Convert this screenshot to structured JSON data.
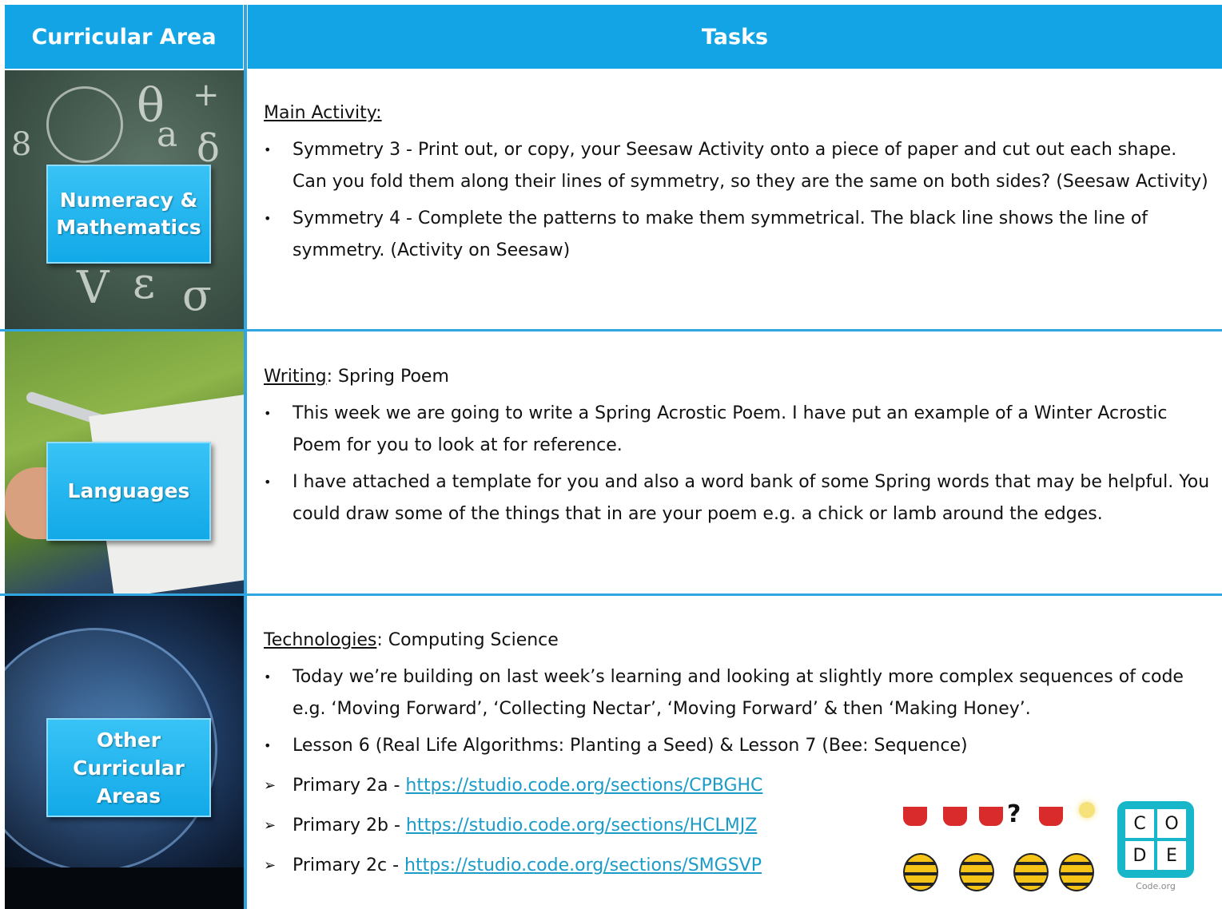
{
  "header": {
    "col_area": "Curricular Area",
    "col_tasks": "Tasks"
  },
  "rows": {
    "numeracy": {
      "label_line1": "Numeracy &",
      "label_line2": "Mathematics",
      "heading": "Main Activity:",
      "bullets": [
        "Symmetry 3 - Print out, or copy, your Seesaw Activity onto a piece of paper and cut out each shape. Can you fold them along their lines of symmetry, so they are the same on both sides? (Seesaw Activity)",
        "Symmetry 4 - Complete the patterns to make them symmetrical. The black line shows the line of symmetry. (Activity on Seesaw)"
      ]
    },
    "languages": {
      "label": "Languages",
      "heading_u": "Writing",
      "heading_rest": ": Spring Poem",
      "bullets": [
        "This week we are going to write a Spring Acrostic Poem. I have put an example of a Winter Acrostic Poem for you to look at for reference.",
        "I have attached a template for you and also a word bank of some Spring words that may be helpful. You could draw some of the things that in are your poem e.g. a chick or lamb around the edges."
      ]
    },
    "other": {
      "label_line1": "Other",
      "label_line2": "Curricular",
      "label_line3": "Areas",
      "heading_u": "Technologies",
      "heading_rest": ": Computing Science",
      "bullets": [
        "Today we’re building on last week’s learning and looking at slightly more complex sequences of code e.g. ‘Moving Forward’, ‘Collecting Nectar’, ‘Moving Forward’ & then ‘Making Honey’.",
        "Lesson 6 (Real Life Algorithms: Planting a Seed) & Lesson 7 (Bee: Sequence)"
      ],
      "links": [
        {
          "label": "Primary 2a - ",
          "url": "https://studio.code.org/sections/CPBGHC"
        },
        {
          "label": "Primary 2b - ",
          "url": "https://studio.code.org/sections/HCLMJZ"
        },
        {
          "label": "Primary 2c - ",
          "url": "https://studio.code.org/sections/SMGSVP"
        }
      ]
    }
  },
  "code_logo": {
    "letters": [
      "C",
      "O",
      "D",
      "E"
    ],
    "caption": "Code.org",
    "color": "#18b6c9"
  },
  "colors": {
    "header_bg": "#12a4e4",
    "label_bg": "#1eb0ee",
    "link": "#1a9bc8"
  }
}
